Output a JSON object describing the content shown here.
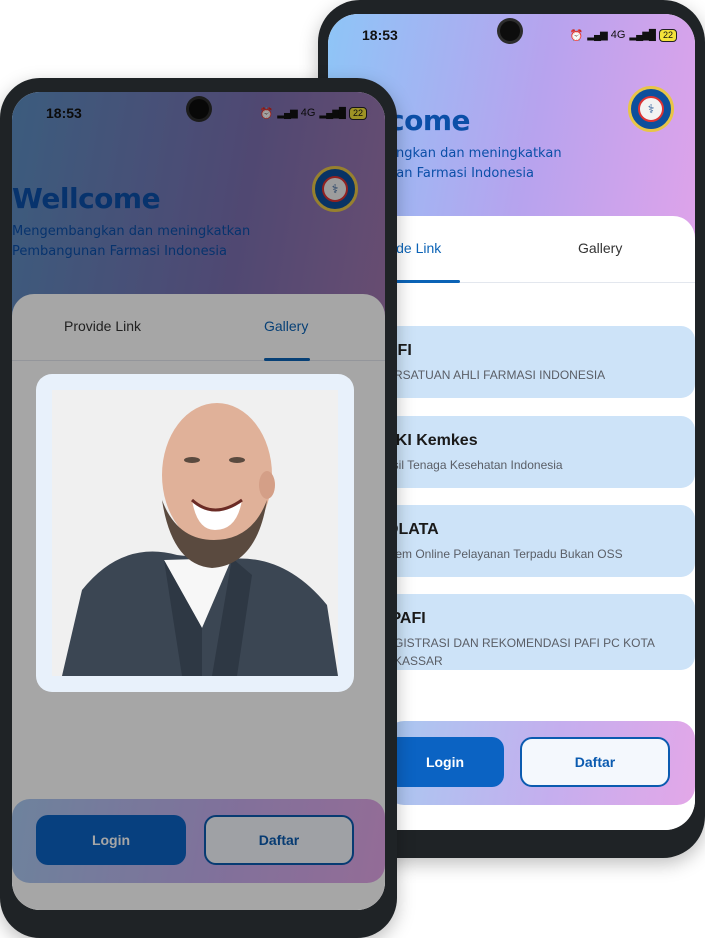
{
  "status": {
    "time": "18:53",
    "network": "4G",
    "battery": "22"
  },
  "app": {
    "welcome_back": "come",
    "welcome_front": "Wellcome",
    "tagline_back_1": "angkan dan meningkatkan",
    "tagline_back_2": "nan Farmasi Indonesia",
    "tagline_front_1": "Mengembangkan dan meningkatkan",
    "tagline_front_2": "Pembangunan Farmasi Indonesia",
    "logo_text": "PAFI"
  },
  "tabs": {
    "provide_back": "vide Link",
    "gallery": "Gallery",
    "provide_front": "Provide Link"
  },
  "links": [
    {
      "title": "AFI",
      "subtitle": "ERSATUAN AHLI FARMASI INDONESIA"
    },
    {
      "title": "TKI Kemkes",
      "subtitle": "nsil Tenaga Kesehatan Indonesia"
    },
    {
      "title": "OLATA",
      "subtitle": "stem Online Pelayanan Terpadu Bukan OSS"
    },
    {
      "title": "IPAFI",
      "subtitle": "EGISTRASI DAN REKOMENDASI PAFI PC KOTA AKASSAR"
    }
  ],
  "buttons": {
    "login": "Login",
    "daftar": "Daftar"
  },
  "colors": {
    "primary": "#0b63c3",
    "accent_gradient_start": "#8ec5f7",
    "accent_gradient_end": "#dfa3ea"
  }
}
